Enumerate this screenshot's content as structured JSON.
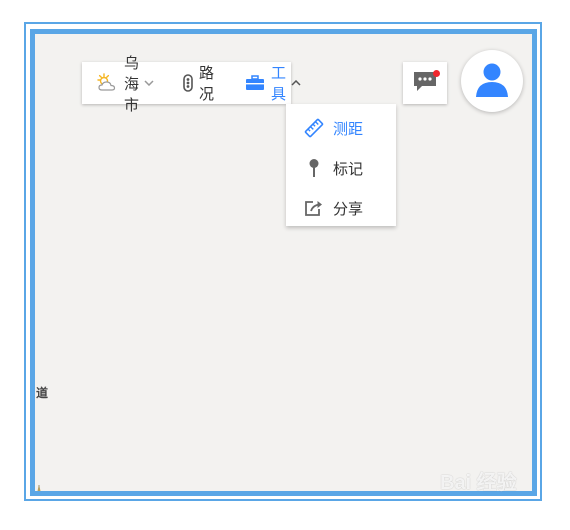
{
  "toolbar": {
    "city_label": "乌海市",
    "traffic_label": "路况",
    "tools_label": "工具"
  },
  "tools_menu": {
    "items": [
      {
        "label": "测距",
        "icon": "ruler-icon",
        "active": true
      },
      {
        "label": "标记",
        "icon": "pin-icon",
        "active": false
      },
      {
        "label": "分享",
        "icon": "share-icon",
        "active": false
      }
    ]
  },
  "map": {
    "road_label": "道"
  },
  "watermark": {
    "text": "Bai 经验"
  },
  "colors": {
    "accent": "#3385ff",
    "frame": "#5aa6e6",
    "map_bg": "#f3f2f0",
    "badge": "#f0262c",
    "avatar": "#3385ff"
  }
}
